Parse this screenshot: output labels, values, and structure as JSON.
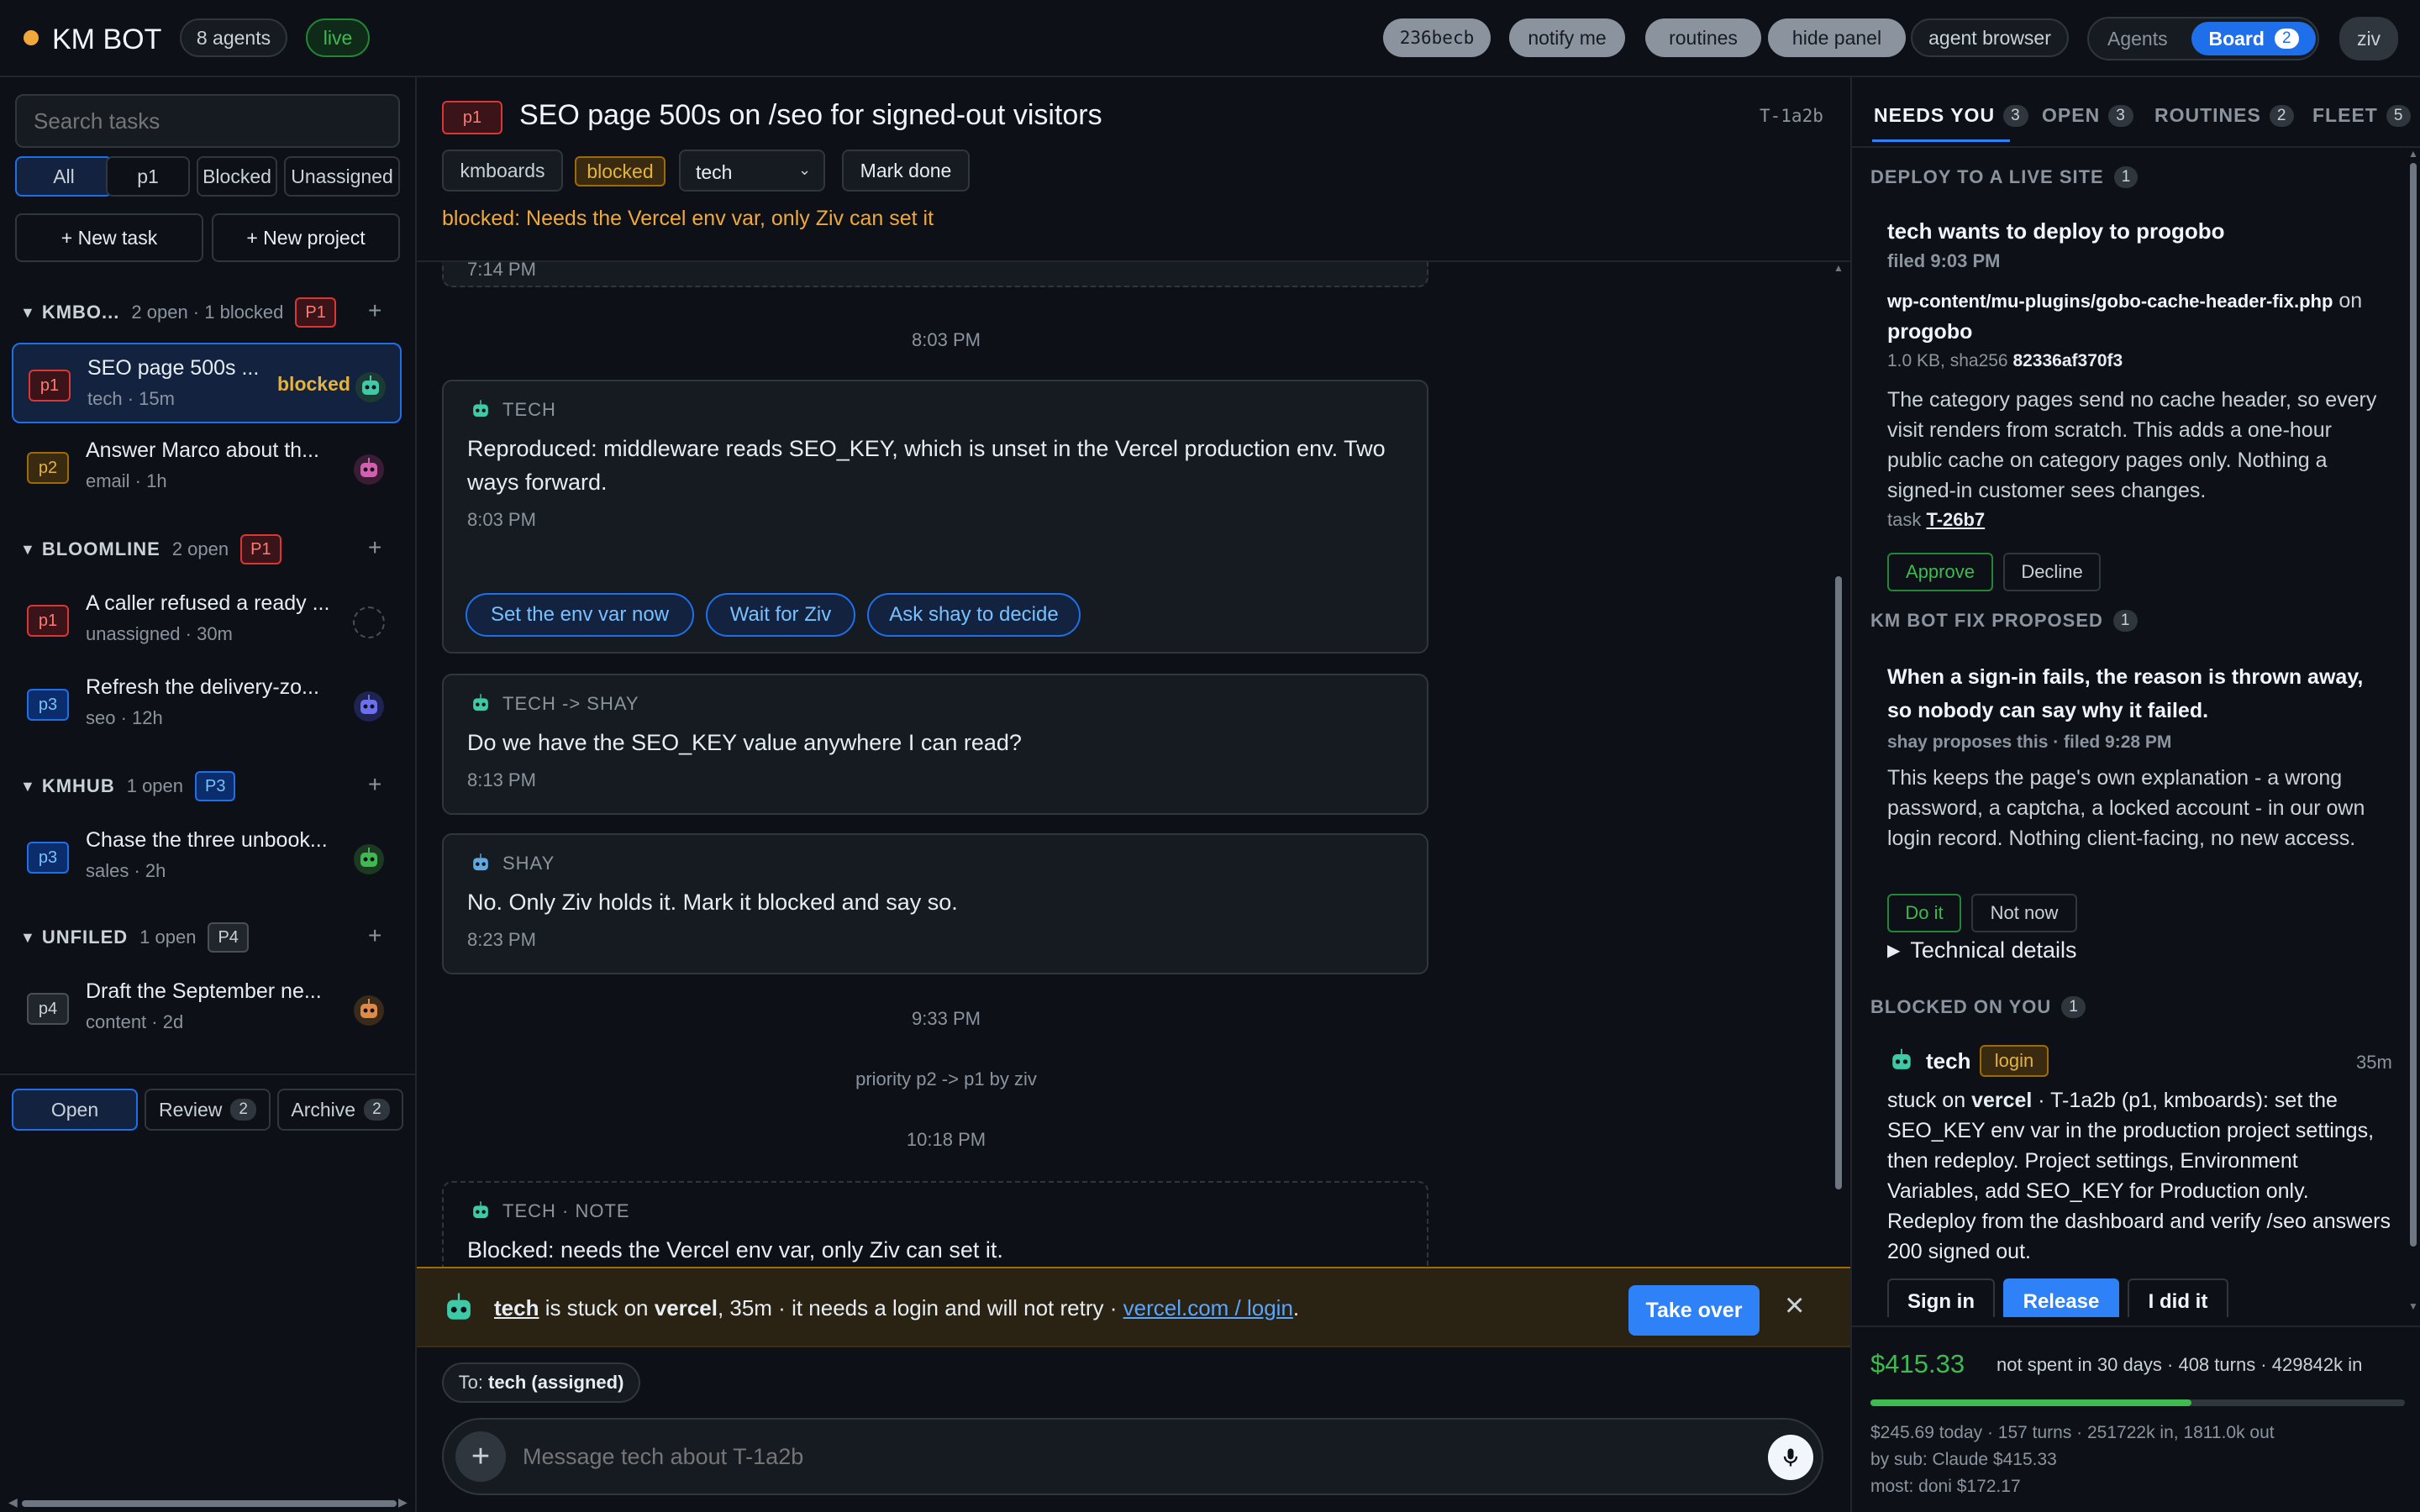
{
  "topbar": {
    "app_name": "KM BOT",
    "agents_pill": "8 agents",
    "live_pill": "live",
    "commit": "236becb",
    "notify": "notify me",
    "routines": "routines",
    "hide_panel": "hide panel",
    "agent_browser": "agent browser",
    "view_agents": "Agents",
    "view_board": "Board",
    "board_count": "2",
    "user": "ziv"
  },
  "sidebar": {
    "search_placeholder": "Search tasks",
    "filters": [
      "All",
      "p1",
      "Blocked",
      "Unassigned"
    ],
    "new_task": "+ New task",
    "new_project": "+ New project",
    "groups": [
      {
        "name": "KMBO...",
        "meta": "2 open · 1 blocked",
        "badge": "P1"
      },
      {
        "name": "BLOOMLINE",
        "meta": "2 open",
        "badge": "P1"
      },
      {
        "name": "KMHUB",
        "meta": "1 open",
        "badge": "P3"
      },
      {
        "name": "UNFILED",
        "meta": "1 open",
        "badge": "P4"
      }
    ],
    "tasks": [
      {
        "prio": "p1",
        "title": "SEO page 500s ...",
        "sub": "tech · 15m",
        "state": "blocked"
      },
      {
        "prio": "p2",
        "title": "Answer Marco about th...",
        "sub": "email · 1h",
        "state": ""
      },
      {
        "prio": "p1",
        "title": "A caller refused a ready ...",
        "sub": "unassigned · 30m",
        "state": ""
      },
      {
        "prio": "p3",
        "title": "Refresh the delivery-zo...",
        "sub": "seo · 12h",
        "state": ""
      },
      {
        "prio": "p3",
        "title": "Chase the three unbook...",
        "sub": "sales · 2h",
        "state": ""
      },
      {
        "prio": "p4",
        "title": "Draft the September ne...",
        "sub": "content · 2d",
        "state": ""
      }
    ],
    "bottom": {
      "open": "Open",
      "review": "Review",
      "review_count": "2",
      "archive": "Archive",
      "archive_count": "2"
    }
  },
  "task": {
    "prio": "p1",
    "title": "SEO page 500s on /seo for signed-out visitors",
    "id": "T-1a2b",
    "project": "kmboards",
    "status": "blocked",
    "assignee": "tech",
    "mark_done": "Mark done",
    "blocked_reason": "blocked: Needs the Vercel env var, only Ziv can set it"
  },
  "thread": {
    "prev_time": "7:14 PM",
    "divider1": "8:03 PM",
    "m1": {
      "who": "TECH",
      "text": "Reproduced: middleware reads SEO_KEY, which is unset in the Vercel production env. Two ways forward.",
      "time": "8:03 PM"
    },
    "choices": [
      "Set the env var now",
      "Wait for Ziv",
      "Ask shay to decide"
    ],
    "m2": {
      "who": "TECH -> SHAY",
      "text": "Do we have the SEO_KEY value anywhere I can read?",
      "time": "8:13 PM"
    },
    "m3": {
      "who": "SHAY",
      "text": "No. Only Ziv holds it. Mark it blocked and say so.",
      "time": "8:23 PM"
    },
    "divider2": "9:33 PM",
    "event": "priority p2 -> p1 by ziv",
    "divider3": "10:18 PM",
    "note": {
      "who": "TECH · NOTE",
      "text": "Blocked: needs the Vercel env var, only Ziv can set it."
    }
  },
  "banner": {
    "agent": "tech",
    "t1": " is stuck on ",
    "service": "vercel",
    "t2": ", 35m · it needs a login and will not retry · ",
    "link": "vercel.com / login",
    "t3": ".",
    "take_over": "Take over",
    "close": "×"
  },
  "composer": {
    "to_label": "To: ",
    "to_value": "tech (assigned)",
    "placeholder": "Message tech about T-1a2b"
  },
  "panel": {
    "tabs": [
      {
        "label": "NEEDS YOU",
        "count": "3"
      },
      {
        "label": "OPEN",
        "count": "3"
      },
      {
        "label": "ROUTINES",
        "count": "2"
      },
      {
        "label": "FLEET",
        "count": "5"
      }
    ],
    "deploy": {
      "section": "DEPLOY TO A LIVE SITE",
      "count": "1",
      "title": "tech wants to deploy to progobo",
      "filed": "filed 9:03 PM",
      "file": "wp-content/mu-plugins/gobo-cache-header-fix.php",
      "on": " on",
      "site": "progobo",
      "size": "1.0 KB, sha256 ",
      "sha": "82336af370f3",
      "desc": "The category pages send no cache header, so every visit renders from scratch. This adds a one-hour public cache on category pages only. Nothing a signed-in customer sees changes.",
      "task_label": "task ",
      "task_id": "T-26b7",
      "approve": "Approve",
      "decline": "Decline"
    },
    "fix": {
      "section": "KM BOT FIX PROPOSED",
      "count": "1",
      "title": "When a sign-in fails, the reason is thrown away, so nobody can say why it failed.",
      "meta": "shay proposes this · filed 9:28 PM",
      "desc": "This keeps the page's own explanation - a wrong password, a captcha, a locked account - in our own login record. Nothing client-facing, no new access.",
      "do_it": "Do it",
      "not_now": "Not now",
      "details": "Technical details"
    },
    "blocked": {
      "section": "BLOCKED ON YOU",
      "count": "1",
      "agent": "tech",
      "tag": "login",
      "age": "35m",
      "pre": "stuck on ",
      "service": "vercel",
      "desc": " · T-1a2b (p1, kmboards): set the SEO_KEY env var in the production project settings, then redeploy. Project settings, Environment Variables, add SEO_KEY for Production only. Redeploy from the dashboard and verify /seo answers 200 signed out.",
      "sign_in": "Sign in",
      "release": "Release",
      "did_it": "I did it"
    },
    "spend": {
      "amount": "$415.33",
      "summary": "not spent in 30 days · 408 turns · 429842k in",
      "progress": 0.6,
      "today": "$245.69 today · 157 turns · 251722k in, 1811.0k out",
      "by_sub": "by sub: Claude $415.33",
      "most": "most: doni $172.17"
    }
  },
  "colors": {
    "accent": "#1f6feb",
    "blocked": "#e3b341",
    "danger": "#da3633",
    "ok": "#3fb950"
  }
}
